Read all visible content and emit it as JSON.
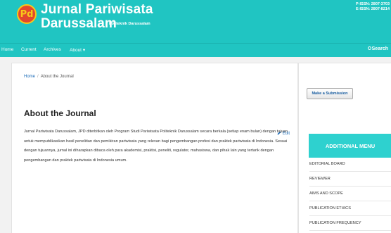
{
  "header": {
    "logo_text": "Pd",
    "title_line1": "Jurnal Pariwisata",
    "title_line2": "Darussalam",
    "subtitle": "Politeknik Darussalam",
    "issn_print": "P-ISSN: 2807-3703",
    "issn_online": "E-ISSN: 2807-8214",
    "bg_color": "#20c5c2"
  },
  "nav": {
    "items": [
      "Home",
      "Current",
      "Archives",
      "About"
    ],
    "about_caret": "▾",
    "search_label": "Search"
  },
  "breadcrumb": {
    "home": "Home",
    "separator": "/",
    "current": "About the Journal"
  },
  "main": {
    "title": "About the Journal",
    "edit_label": "Edit",
    "edit_icon": "pencil-icon",
    "description": "Jurnal Pariwisata Darussalam, JPD diterbitkan oleh Program Studi Pariwisata Politeknik Darussalam secara berkala (setiap enam bulan) dengan tujuan untuk mempublikasikan hasil penelitian dan pemikiran pariwisata yang relevan bagi pengembangan profesi dan praktek pariwisata di Indonesia. Sesuai dengan tujuannya, jurnal ini diharapkan dibaca oleh para akademisi, praktisi, peneliti, regulator, mahasiswa, dan pihak lain yang tertarik dengan pengembangan dan praktek pariwisata di Indonesia umum."
  },
  "sidebar": {
    "submit_label": "Make a Submission",
    "menu_title": "ADDITIONAL MENU",
    "menu_items": [
      "EDITORIAL BOARD",
      "REVIEWER",
      "AIMS AND SCOPE",
      "PUBLICATION ETHICS",
      "PUBLICATION FREQUENCY"
    ]
  }
}
